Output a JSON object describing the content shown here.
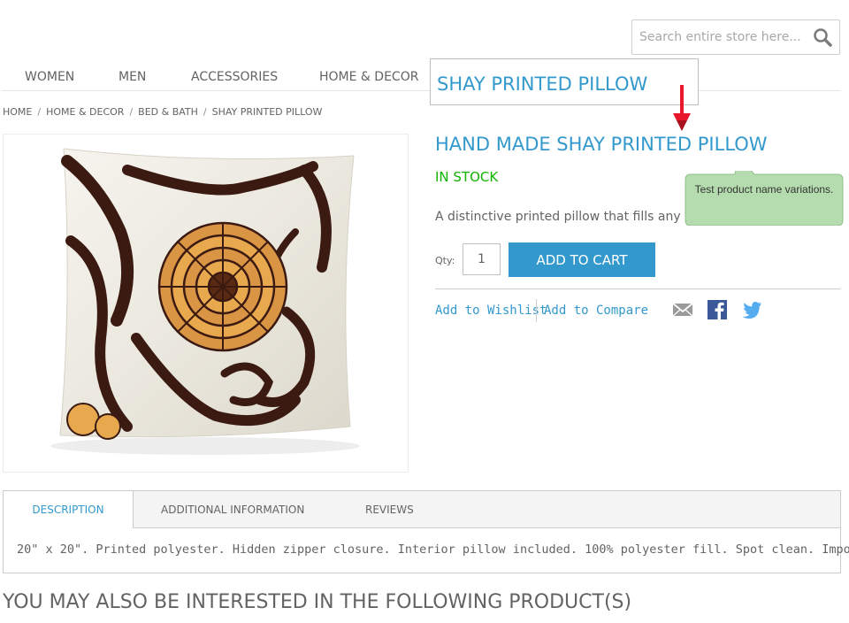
{
  "search": {
    "placeholder": "Search entire store here...",
    "icon": "magnifier"
  },
  "nav": {
    "items": [
      "WOMEN",
      "MEN",
      "ACCESSORIES",
      "HOME & DECOR"
    ]
  },
  "callout": {
    "title": "SHAY PRINTED PILLOW",
    "arrow_color": "#e8182b"
  },
  "breadcrumb": [
    "HOME",
    "HOME & DECOR",
    "BED & BATH",
    "SHAY PRINTED PILLOW"
  ],
  "product": {
    "name": "HAND MADE SHAY PRINTED PILLOW",
    "availability": "IN STOCK",
    "short_description": "A distinctive printed pillow that fills any r",
    "qty_label": "Qty:",
    "qty_value": "1",
    "add_to_cart": "ADD TO CART",
    "add_to_wishlist": "Add to Wishlist",
    "add_to_compare": "Add to Compare",
    "share_icons": [
      "email-icon",
      "facebook-icon",
      "twitter-icon"
    ]
  },
  "tooltip": {
    "text": "Test product name variations."
  },
  "tabs": {
    "items": [
      "DESCRIPTION",
      "ADDITIONAL INFORMATION",
      "REVIEWS"
    ],
    "active_index": 0,
    "description_text": "20\" x 20\". Printed polyester. Hidden zipper closure. Interior pillow included. 100% polyester fill. Spot clean. Imported."
  },
  "upsell": {
    "heading": "YOU MAY ALSO BE INTERESTED IN THE FOLLOWING PRODUCT(S)"
  },
  "colors": {
    "accent": "#3399cc",
    "in_stock": "#11b400",
    "text": "#636363",
    "tooltip_bg": "#b5dcae"
  }
}
